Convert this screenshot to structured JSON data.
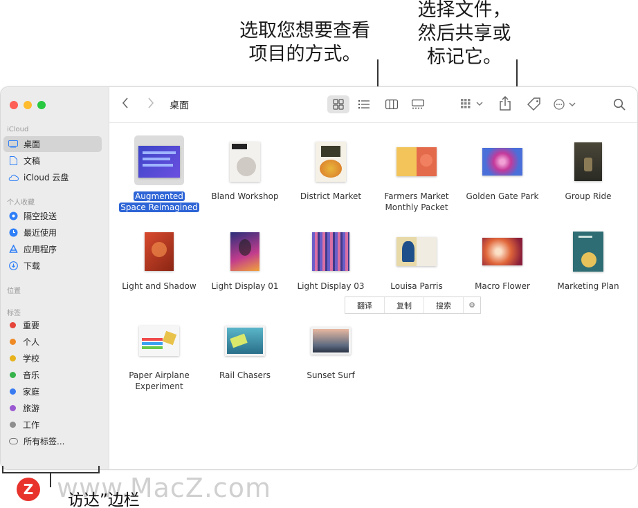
{
  "annotations": {
    "view_callout_line1": "选取您想要查看",
    "view_callout_line2": "项目的方式。",
    "share_callout_line1": "选择文件，",
    "share_callout_line2": "然后共享或",
    "share_callout_line3": "标记它。",
    "sidebar_callout": "访达”边栏"
  },
  "window": {
    "title": "桌面"
  },
  "sidebar": {
    "icloud_header": "iCloud",
    "icloud_items": [
      {
        "label": "桌面",
        "icon": "desktop-icon",
        "selected": true
      },
      {
        "label": "文稿",
        "icon": "document-icon"
      },
      {
        "label": "iCloud 云盘",
        "icon": "cloud-icon"
      }
    ],
    "favorites_header": "个人收藏",
    "favorite_items": [
      {
        "label": "隔空投送",
        "icon": "airdrop-icon"
      },
      {
        "label": "最近使用",
        "icon": "clock-icon"
      },
      {
        "label": "应用程序",
        "icon": "apps-icon"
      },
      {
        "label": "下载",
        "icon": "download-icon"
      }
    ],
    "locations_header": "位置",
    "tags_header": "标签",
    "tags": [
      {
        "label": "重要",
        "color": "#e5453a"
      },
      {
        "label": "个人",
        "color": "#ef8a24"
      },
      {
        "label": "学校",
        "color": "#e7b21c"
      },
      {
        "label": "音乐",
        "color": "#36b24a"
      },
      {
        "label": "家庭",
        "color": "#3a7bf2"
      },
      {
        "label": "旅游",
        "color": "#9a59d1"
      },
      {
        "label": "工作",
        "color": "#8e8e8e"
      }
    ],
    "all_tags": "所有标签..."
  },
  "files": [
    {
      "label_lines": [
        "Augmented",
        "Space Reimagined"
      ],
      "selected": true,
      "thumb": "blue-poster"
    },
    {
      "label_lines": [
        "Bland Workshop"
      ],
      "thumb": "bland-workshop"
    },
    {
      "label_lines": [
        "District Market"
      ],
      "thumb": "district-market"
    },
    {
      "label_lines": [
        "Farmers Market",
        "Monthly Packet"
      ],
      "thumb": "farmers-market"
    },
    {
      "label_lines": [
        "Golden Gate Park"
      ],
      "thumb": "flower-photo"
    },
    {
      "label_lines": [
        "Group Ride"
      ],
      "thumb": "group-ride"
    },
    {
      "label_lines": [
        "Light and Shadow"
      ],
      "thumb": "light-shadow"
    },
    {
      "label_lines": [
        "Light Display 01"
      ],
      "thumb": "light-display-01"
    },
    {
      "label_lines": [
        "Light Display 03"
      ],
      "thumb": "light-display-03"
    },
    {
      "label_lines": [
        "Louisa Parris"
      ],
      "thumb": "louisa-parris"
    },
    {
      "label_lines": [
        "Macro Flower"
      ],
      "thumb": "macro-flower"
    },
    {
      "label_lines": [
        "Marketing Plan"
      ],
      "thumb": "marketing-plan"
    },
    {
      "label_lines": [
        "Paper Airplane",
        "Experiment"
      ],
      "thumb": "paper-airplane"
    },
    {
      "label_lines": [
        "Rail Chasers"
      ],
      "thumb": "rail-chasers"
    },
    {
      "label_lines": [
        "Sunset Surf"
      ],
      "thumb": "sunset-surf"
    }
  ],
  "context_strip": {
    "translate": "翻译",
    "copy": "复制",
    "search": "搜索"
  },
  "watermark": {
    "logo_letter": "Z",
    "text": "www.MacZ.com"
  }
}
